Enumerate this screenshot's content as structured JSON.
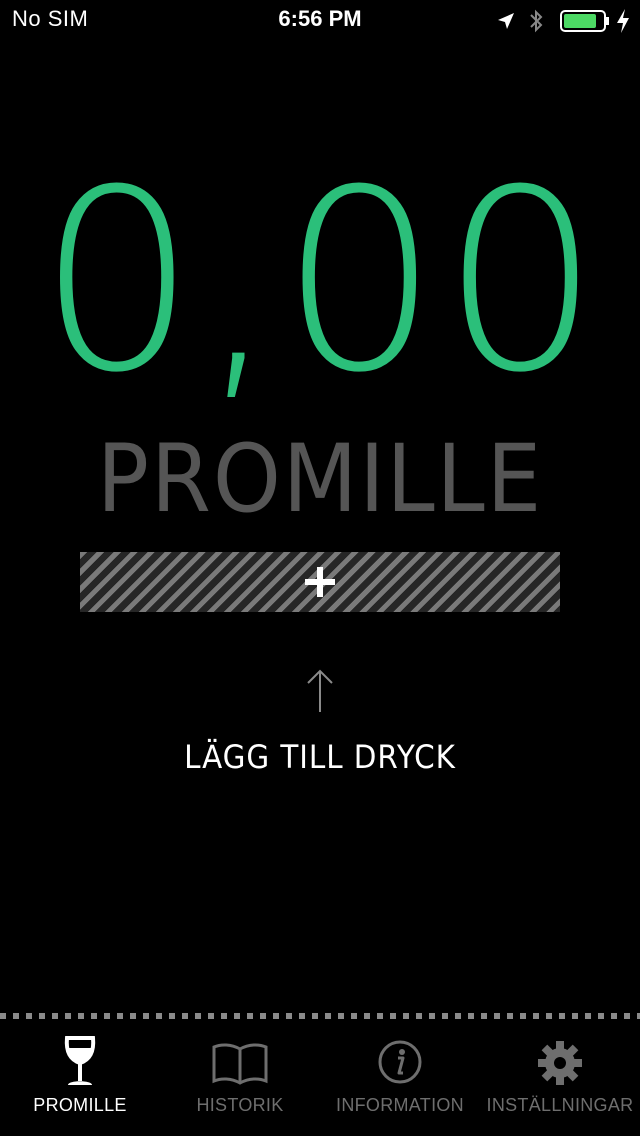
{
  "status_bar": {
    "carrier": "No SIM",
    "time": "6:56 PM",
    "battery_color": "#4cd964"
  },
  "reading": {
    "value": "0,00",
    "color": "#2bbf7a"
  },
  "unit_label": "PROMILLE",
  "add_drink": {
    "icon": "plus-icon",
    "hint": "LÄGG TILL DRYCK"
  },
  "tabs": [
    {
      "label": "PROMILLE",
      "icon": "wine-glass-icon",
      "active": true
    },
    {
      "label": "HISTORIK",
      "icon": "book-icon",
      "active": false
    },
    {
      "label": "INFORMATION",
      "icon": "info-icon",
      "active": false
    },
    {
      "label": "INSTÄLLNINGAR",
      "icon": "gear-icon",
      "active": false
    }
  ]
}
